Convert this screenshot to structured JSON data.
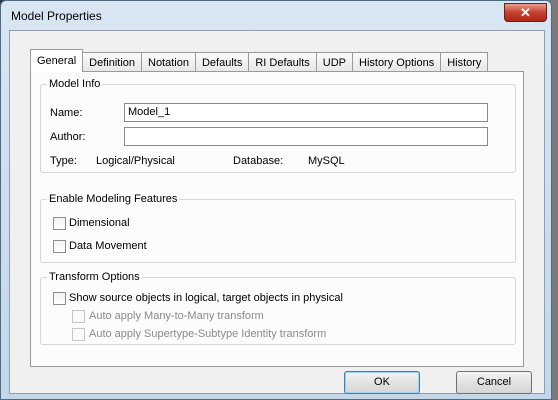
{
  "window": {
    "title": "Model Properties",
    "close_glyph": "✕"
  },
  "tabs": [
    {
      "label": "General",
      "active": true
    },
    {
      "label": "Definition",
      "active": false
    },
    {
      "label": "Notation",
      "active": false
    },
    {
      "label": "Defaults",
      "active": false
    },
    {
      "label": "RI Defaults",
      "active": false
    },
    {
      "label": "UDP",
      "active": false
    },
    {
      "label": "History Options",
      "active": false
    },
    {
      "label": "History",
      "active": false
    }
  ],
  "model_info": {
    "legend": "Model Info",
    "name_label": "Name:",
    "name_value": "Model_1",
    "author_label": "Author:",
    "author_value": "",
    "type_label": "Type:",
    "type_value": "Logical/Physical",
    "database_label": "Database:",
    "database_value": "MySQL"
  },
  "modeling_features": {
    "legend": "Enable Modeling Features",
    "dimensional": {
      "label": "Dimensional",
      "checked": false
    },
    "data_movement": {
      "label": "Data Movement",
      "checked": false
    }
  },
  "transform_options": {
    "legend": "Transform Options",
    "show_source": {
      "label": "Show source objects in logical, target objects in physical",
      "checked": false
    },
    "many_to_many": {
      "label": "Auto apply Many-to-Many transform",
      "checked": false,
      "disabled": true
    },
    "supertype_subtype": {
      "label": "Auto apply Supertype-Subtype Identity transform",
      "checked": false,
      "disabled": true
    }
  },
  "buttons": {
    "ok": "OK",
    "cancel": "Cancel"
  },
  "colors": {
    "title_bar": "#c4d6e8",
    "close_button": "#c4402c",
    "dialog_bg": "#f0f0f0"
  }
}
